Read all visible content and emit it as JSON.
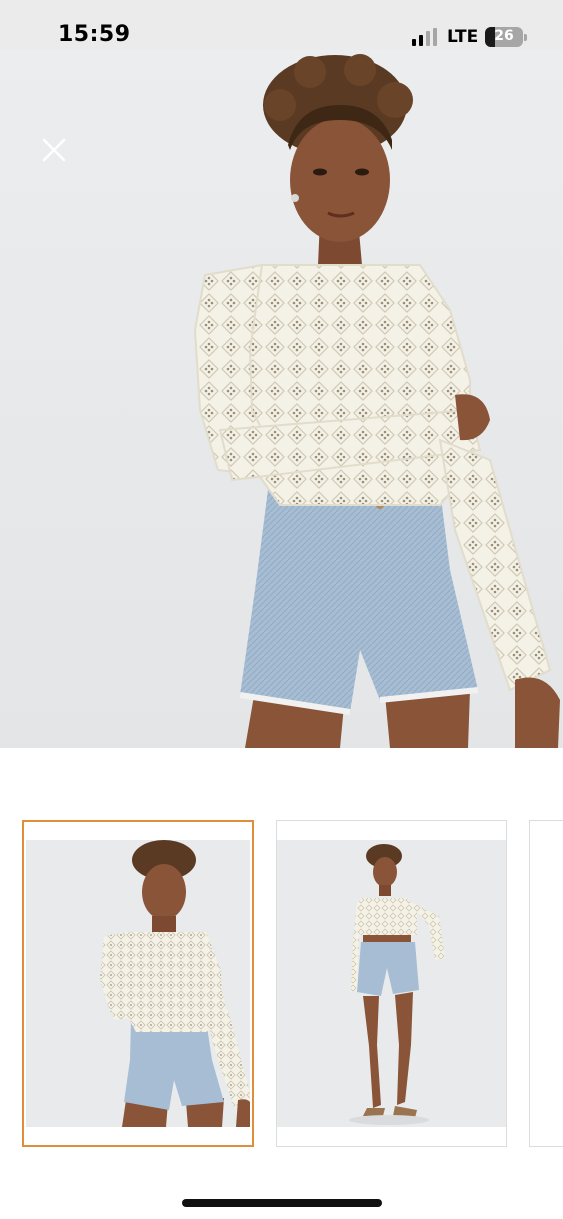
{
  "status_bar": {
    "time": "15:59",
    "network": "LTE",
    "battery_percent": "26",
    "battery_level": 0.26,
    "signal_bars_active": 2,
    "signal_bars_total": 4
  },
  "colors": {
    "status_bar_bg": "#ebebeb",
    "photo_bg": "#e6e8ea",
    "selected_thumb_border": "#e08e3a",
    "thumb_border": "#dcdcdc",
    "sweater": "#f4f1e6",
    "denim": "#a7bdd3",
    "skin": "#8a5438",
    "hair": "#5a3a22"
  },
  "icons": {
    "close": "close-icon",
    "signal": "cellular-signal-icon",
    "battery": "battery-icon"
  },
  "gallery": {
    "selected_index": 0,
    "thumbnails": [
      {
        "view": "front-closeup",
        "selected": true
      },
      {
        "view": "full-body",
        "selected": false
      },
      {
        "view": "partial",
        "selected": false
      }
    ]
  }
}
